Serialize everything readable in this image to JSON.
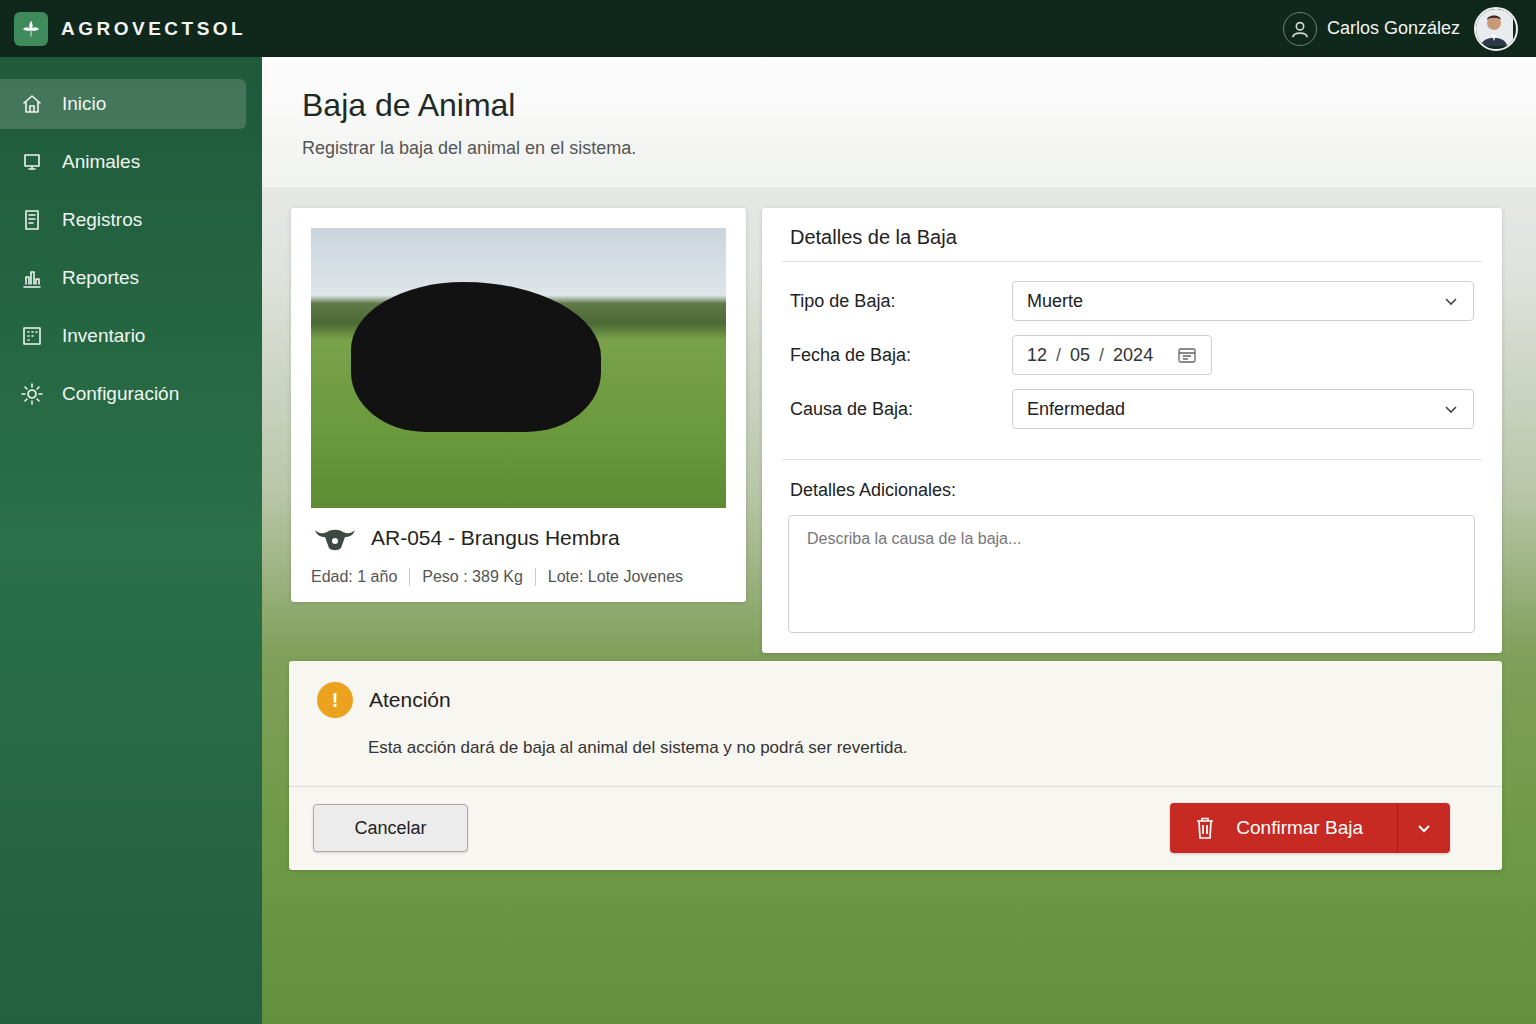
{
  "app": {
    "name": "AGROVECTSOL"
  },
  "user": {
    "name": "Carlos González"
  },
  "sidebar": {
    "items": [
      {
        "label": "Inicio",
        "selected": true
      },
      {
        "label": "Animales",
        "selected": false
      },
      {
        "label": "Registros",
        "selected": false
      },
      {
        "label": "Reportes",
        "selected": false
      },
      {
        "label": "Inventario",
        "selected": false
      },
      {
        "label": "Configuración",
        "selected": false
      }
    ]
  },
  "page": {
    "title": "Baja de Animal",
    "subtitle": "Registrar la baja del animal en el sistema."
  },
  "animal": {
    "title": "AR-054 - Brangus Hembra",
    "facts": [
      "Edad: 1 año",
      "Peso : 389 Kg",
      "Lote: Lote Jovenes"
    ]
  },
  "form": {
    "title": "Detalles de la Baja",
    "fields": [
      {
        "label": "Tipo de Baja:",
        "kind": "select",
        "value": "Muerte"
      },
      {
        "label": "Fecha de Baja:",
        "kind": "date",
        "parts": [
          "12",
          "05",
          "2024"
        ],
        "separator": "/"
      },
      {
        "label": "Causa de Baja:",
        "kind": "select",
        "value": "Enfermedad"
      }
    ],
    "notes": {
      "label": "Detalles Adicionales:",
      "placeholder": "Describa la causa de la baja..."
    }
  },
  "warning": {
    "icon": "!",
    "title": "Atención",
    "message": "Esta acción dará de baja al animal del sistema y no podrá ser revertida."
  },
  "buttons": {
    "cancel": "Cancelar",
    "confirm": "Confirmar Baja"
  }
}
